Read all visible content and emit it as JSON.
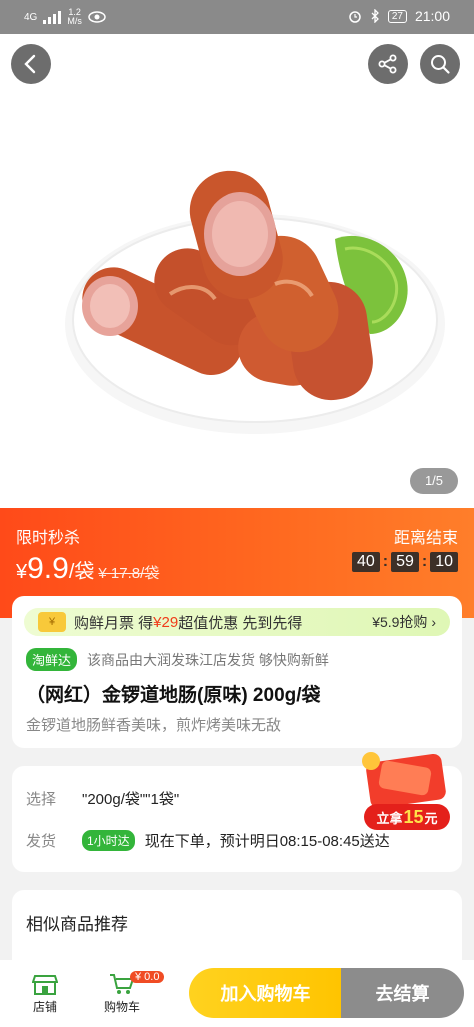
{
  "status_bar": {
    "network": "4G",
    "speed": "1.2",
    "speed_unit": "M/s",
    "battery": "27",
    "time": "21:00"
  },
  "gallery": {
    "page_indicator": "1/5",
    "back_icon": "back-arrow-icon",
    "share_icon": "share-icon",
    "search_icon": "search-icon"
  },
  "flash_sale": {
    "label": "限时秒杀",
    "price_symbol": "¥",
    "price": "9.9",
    "unit": "/袋",
    "old_price": "¥ 17.8/袋",
    "countdown_label": "距离结束",
    "countdown": {
      "h": "40",
      "m": "59",
      "s": "10"
    }
  },
  "product": {
    "promo_coin": "¥",
    "promo_text_1": "购鲜月票 得",
    "promo_highlight": "¥29",
    "promo_text_2": "超值优惠 先到先得",
    "promo_action": "¥5.9抢购",
    "badge": "淘鲜达",
    "ship_note": "该商品由大润发珠江店发货 够快购新鲜",
    "title": "（网红）金锣道地肠(原味) 200g/袋",
    "subtitle": "金锣道地肠鲜香美味，煎炸烤美味无敌"
  },
  "options": {
    "select_label": "选择",
    "select_value": "\"200g/袋\"\"1袋\"",
    "ship_label": "发货",
    "ship_tag": "1小时达",
    "ship_value": "现在下单，预计明日08:15-08:45送达"
  },
  "envelope": {
    "prefix": "立拿",
    "amount": "15",
    "suffix": "元"
  },
  "recommend": {
    "title": "相似商品推荐"
  },
  "bottom_bar": {
    "store_label": "店铺",
    "cart_label": "购物车",
    "cart_badge": "¥ 0.0",
    "add_to_cart": "加入购物车",
    "checkout": "去结算"
  },
  "colors": {
    "accent_orange": "#ff4a19",
    "green": "#33b53a",
    "yellow": "#ffc400"
  }
}
